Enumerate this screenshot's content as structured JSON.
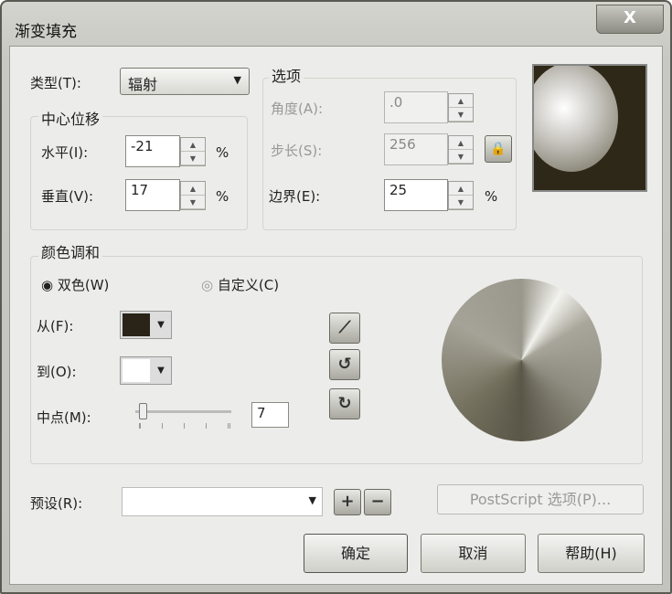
{
  "window": {
    "title": "渐变填充",
    "close": "X"
  },
  "type": {
    "label": "类型(T):",
    "value": "辐射"
  },
  "center": {
    "group": "中心位移",
    "horizontal_label": "水平(I):",
    "horizontal": "-21",
    "vertical_label": "垂直(V):",
    "vertical": "17",
    "unit": "%"
  },
  "options": {
    "group": "选项",
    "angle_label": "角度(A):",
    "angle": ".0",
    "steps_label": "步长(S):",
    "steps": "256",
    "edge_label": "边界(E):",
    "edge": "25",
    "unit": "%"
  },
  "blend": {
    "group": "颜色调和",
    "two_color": "双色(W)",
    "custom": "自定义(C)",
    "from_label": "从(F):",
    "from_color": "#2a2418",
    "to_label": "到(O):",
    "to_color": "#ffffff",
    "mid_label": "中点(M):",
    "mid": "7"
  },
  "presets": {
    "label": "预设(R):",
    "value": "",
    "postscript": "PostScript 选项(P)..."
  },
  "buttons": {
    "ok": "确定",
    "cancel": "取消",
    "help": "帮助(H)"
  }
}
